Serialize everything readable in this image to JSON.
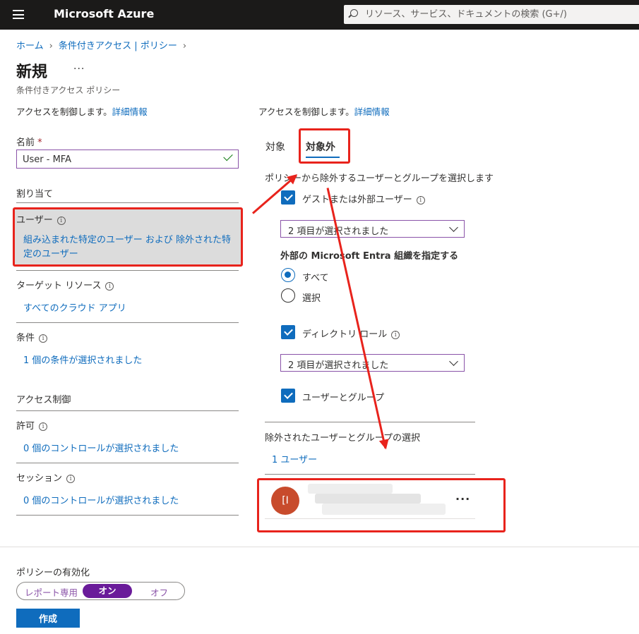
{
  "topbar": {
    "brand": "Microsoft Azure",
    "search_placeholder": "リソース、サービス、ドキュメントの検索 (G+/)"
  },
  "breadcrumb": [
    "ホーム",
    "条件付きアクセス | ポリシー"
  ],
  "page": {
    "title": "新規",
    "more": "···",
    "subtitle": "条件付きアクセス ポリシー"
  },
  "left": {
    "desc_text": "アクセスを制御します。",
    "desc_link": "詳細情報",
    "name_label": "名前",
    "name_required": "*",
    "name_value": "User - MFA",
    "assignments_header": "割り当て",
    "users_label": "ユーザー",
    "users_link": "組み込まれた特定のユーザー および 除外された特定のユーザー",
    "target_label": "ターゲット リソース",
    "target_link": "すべてのクラウド アプリ",
    "conditions_label": "条件",
    "conditions_link": "1 個の条件が選択されました",
    "access_header": "アクセス制御",
    "grant_label": "許可",
    "grant_link": "0 個のコントロールが選択されました",
    "session_label": "セッション",
    "session_link": "0 個のコントロールが選択されました"
  },
  "right": {
    "desc_text": "アクセスを制御します。",
    "desc_link": "詳細情報",
    "tabs": [
      {
        "label": "対象"
      },
      {
        "label": "対象外"
      }
    ],
    "instruction": "ポリシーから除外するユーザーとグループを選択します",
    "guest_label": "ゲストまたは外部ユーザー",
    "guest_dropdown": "2 項目が選択されました",
    "external_header": "外部の Microsoft Entra 組織を指定する",
    "radio_all": "すべて",
    "radio_select": "選択",
    "directory_label": "ディレクトリ ロール",
    "directory_dropdown": "2 項目が選択されました",
    "users_groups_label": "ユーザーとグループ",
    "excluded_header": "除外されたユーザーとグループの選択",
    "excluded_link": "1 ユーザー",
    "user_initial": "[I",
    "user_more": "···"
  },
  "footer": {
    "enable_label": "ポリシーの有効化",
    "toggle_report": "レポート専用",
    "toggle_on": "オン",
    "toggle_off": "オフ",
    "create": "作成"
  },
  "colors": {
    "accent": "#0f6cbd",
    "annotation": "#e8231c",
    "toggle_active": "#6a1b9a",
    "avatar": "#c84b2c"
  }
}
